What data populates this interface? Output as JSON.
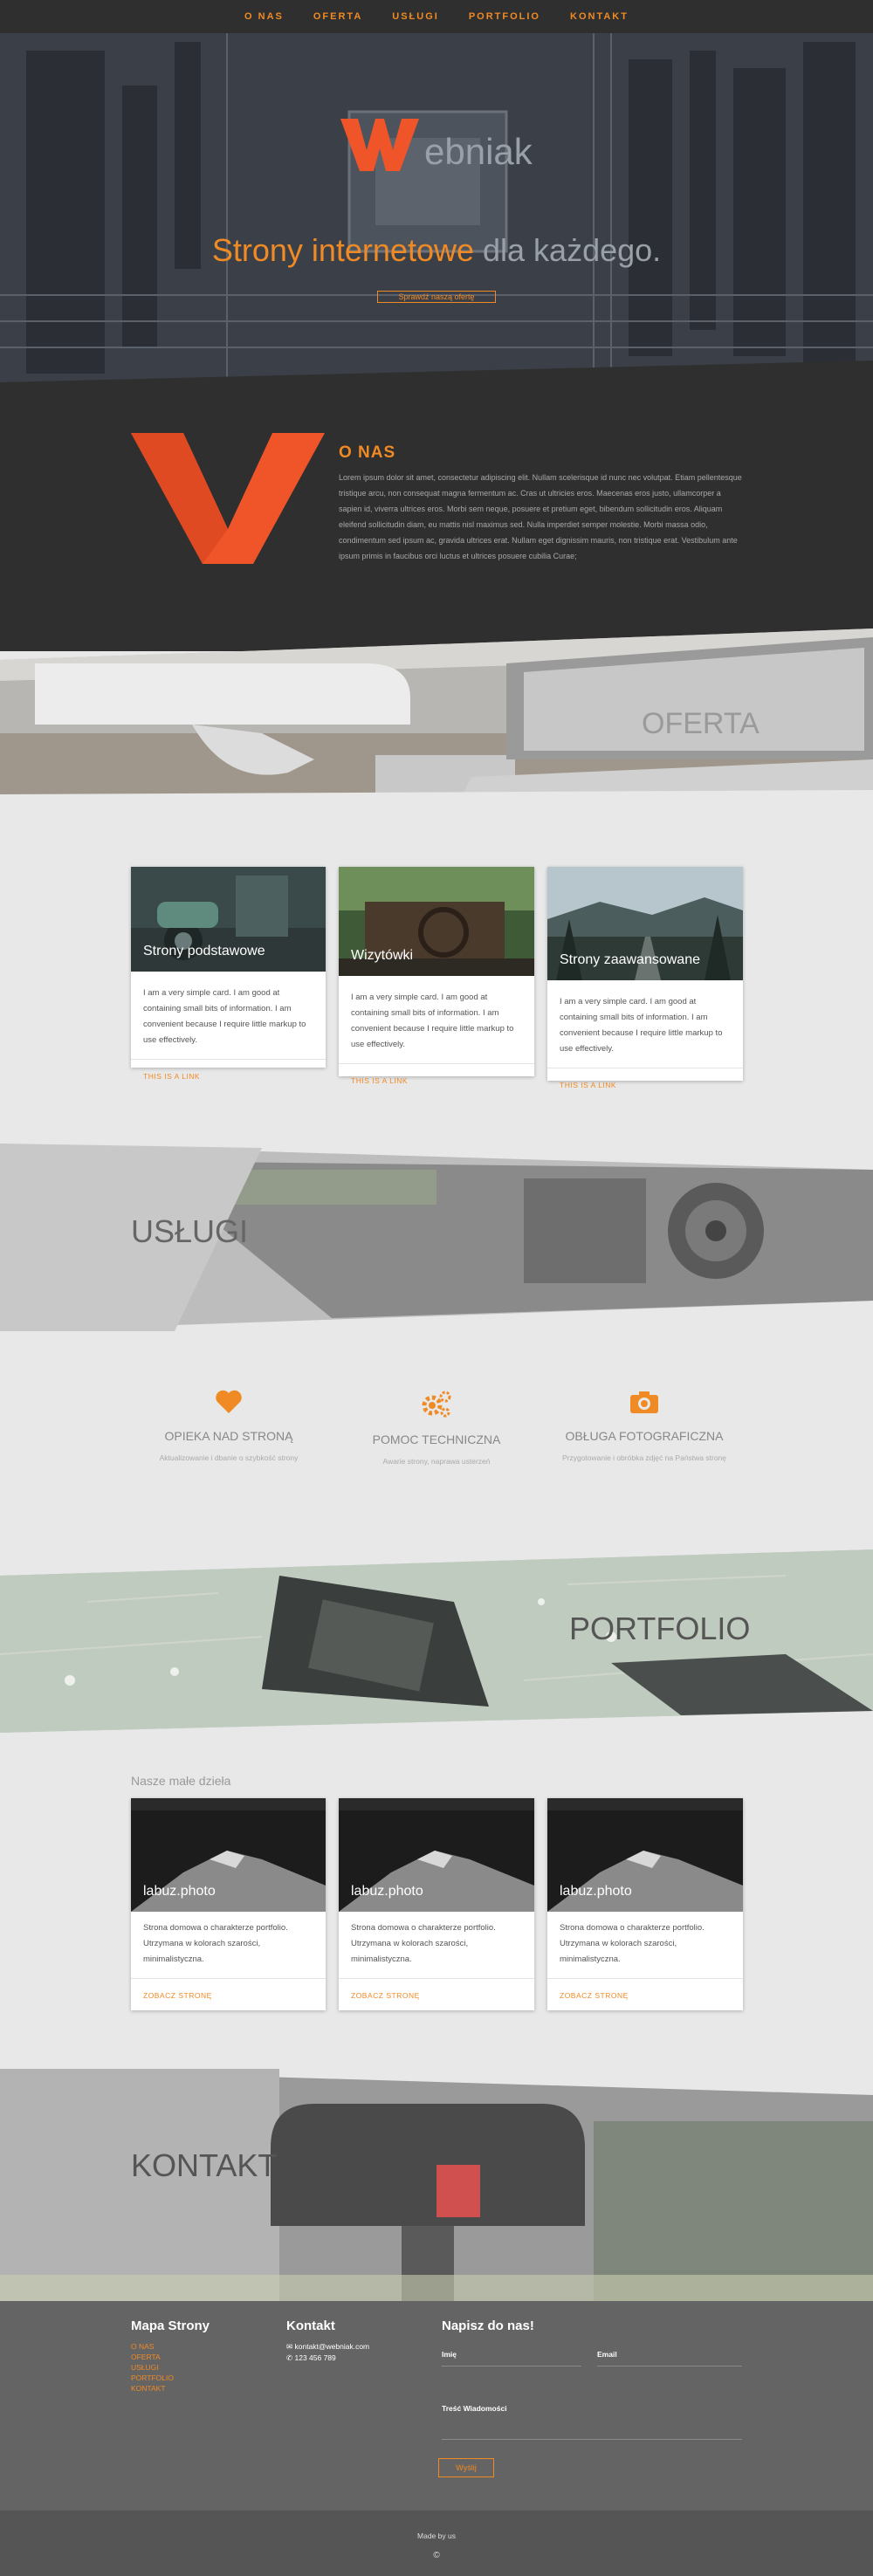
{
  "nav": {
    "items": [
      "O NAS",
      "OFERTA",
      "USŁUGI",
      "PORTFOLIO",
      "KONTAKT"
    ]
  },
  "hero": {
    "logo_text": "ebniak",
    "title_highlight": "Strony internetowe",
    "title_rest": "dla każdego.",
    "button_label": "Sprawdź naszą ofertę"
  },
  "about": {
    "title": "O NAS",
    "text": "Lorem ipsum dolor sit amet, consectetur adipiscing elit. Nullam scelerisque id nunc nec volutpat. Etiam pellentesque tristique arcu, non consequat magna fermentum ac. Cras ut ultricies eros. Maecenas eros justo, ullamcorper a sapien id, viverra ultrices eros. Morbi sem neque, posuere et pretium eget, bibendum sollicitudin eros. Aliquam eleifend sollicitudin diam, eu mattis nisl maximus sed. Nulla imperdiet semper molestie. Morbi massa odio, condimentum sed ipsum ac, gravida ultrices erat. Nullam eget dignissim mauris, non tristique erat. Vestibulum ante ipsum primis in faucibus orci luctus et ultrices posuere cubilia Curae;"
  },
  "oferta": {
    "label": "OFERTA",
    "cards": [
      {
        "title": "Strony podstawowe",
        "text": "I am a very simple card. I am good at containing small bits of information. I am convenient because I require little markup to use effectively.",
        "link": "THIS IS A LINK"
      },
      {
        "title": "Wizytówki",
        "text": "I am a very simple card. I am good at containing small bits of information. I am convenient because I require little markup to use effectively.",
        "link": "THIS IS A LINK"
      },
      {
        "title": "Strony zaawansowane",
        "text": "I am a very simple card. I am good at containing small bits of information. I am convenient because I require little markup to use effectively.",
        "link": "THIS IS A LINK"
      }
    ]
  },
  "uslugi": {
    "label": "USŁUGI",
    "services": [
      {
        "icon": "heart-icon",
        "title": "OPIEKA NAD STRONĄ",
        "desc": "Aktualizowanie i dbanie o szybkość strony"
      },
      {
        "icon": "gears-icon",
        "title": "POMOC TECHNICZNA",
        "desc": "Awarie strony, naprawa usterzeń"
      },
      {
        "icon": "camera-icon",
        "title": "OBŁUGA FOTOGRAFICZNA",
        "desc": "Przygotowanie i obróbka zdjęć na Państwa stronę"
      }
    ]
  },
  "portfolio": {
    "label": "PORTFOLIO",
    "subtitle": "Nasze małe dzieła",
    "items": [
      {
        "title": "labuz.photo",
        "text": "Strona domowa o charakterze portfolio. Utrzymana w kolorach szarości, minimalistyczna.",
        "link": "ZOBACZ STRONĘ"
      },
      {
        "title": "labuz.photo",
        "text": "Strona domowa o charakterze portfolio. Utrzymana w kolorach szarości, minimalistyczna.",
        "link": "ZOBACZ STRONĘ"
      },
      {
        "title": "labuz.photo",
        "text": "Strona domowa o charakterze portfolio. Utrzymana w kolorach szarości, minimalistyczna.",
        "link": "ZOBACZ STRONĘ"
      }
    ]
  },
  "kontakt": {
    "label": "KONTAKT"
  },
  "footer": {
    "sitemap_title": "Mapa Strony",
    "sitemap": [
      "O NAS",
      "OFERTA",
      "USŁUGI",
      "PORTFOLIO",
      "KONTAKT"
    ],
    "contact_title": "Kontakt",
    "email": "kontakt@webniak.com",
    "phone": "123 456 789",
    "form_title": "Napisz do nas!",
    "name_label": "Imię",
    "email_label": "Email",
    "message_label": "Treść Wiadomości",
    "send_label": "Wyślij",
    "made_by": "Made by us"
  },
  "colors": {
    "accent": "#f08a24",
    "logo_red": "#f0552a",
    "dark": "#2f2f2f",
    "footer": "#646464"
  }
}
